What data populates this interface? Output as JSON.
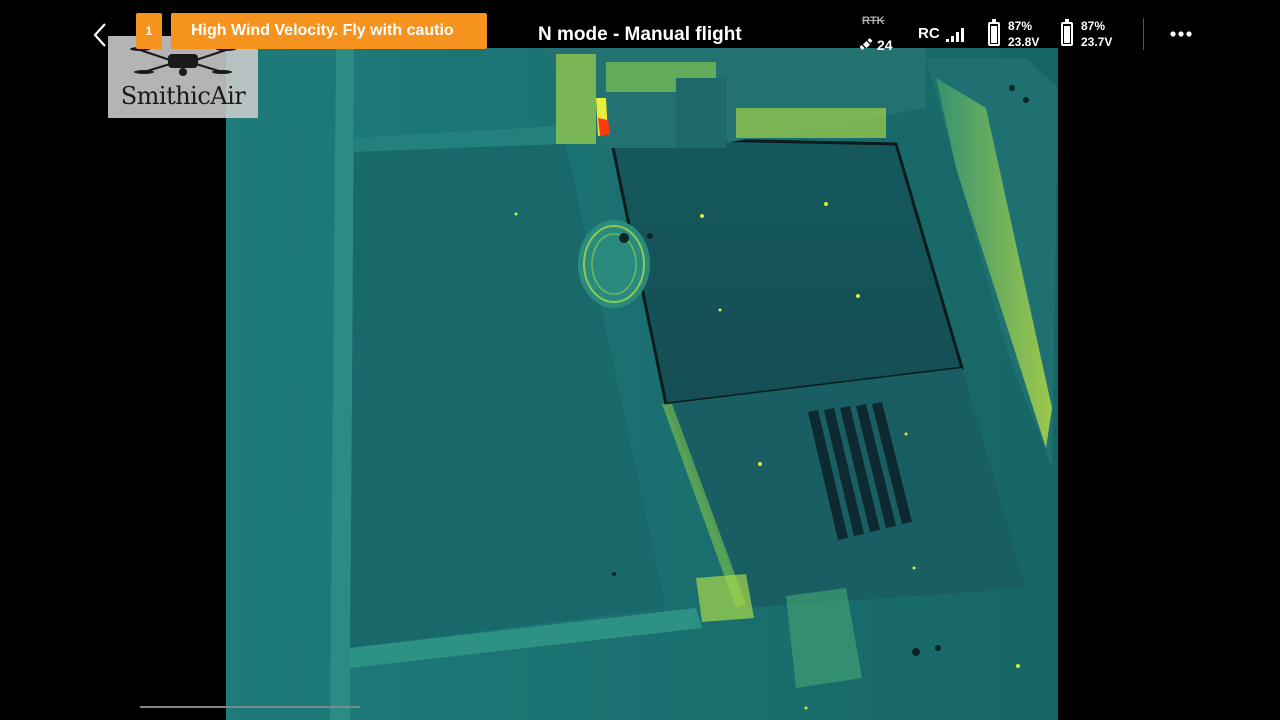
{
  "topbar": {
    "warning_count": "1",
    "warning_text": "High Wind Velocity. Fly with cautio",
    "flight_mode": "N mode - Manual flight",
    "rtk_label": "RTK",
    "satellite_count": "24",
    "rc_label": "RC",
    "batteries": [
      {
        "percent": "87%",
        "voltage": "23.8V",
        "level": 0.87
      },
      {
        "percent": "87%",
        "voltage": "23.7V",
        "level": 0.87
      }
    ]
  },
  "watermark": {
    "brand": "SmithicAir"
  },
  "colors": {
    "warning": "#f5931e",
    "thermal_base": "#1a6a6c",
    "thermal_hot": "#e2ee3a",
    "thermal_hottest": "#ff3300"
  },
  "icons": {
    "back": "chevron-left-icon",
    "satellite": "satellite-icon",
    "signal": "signal-bars-icon",
    "battery": "battery-icon",
    "more": "more-dots-icon"
  }
}
